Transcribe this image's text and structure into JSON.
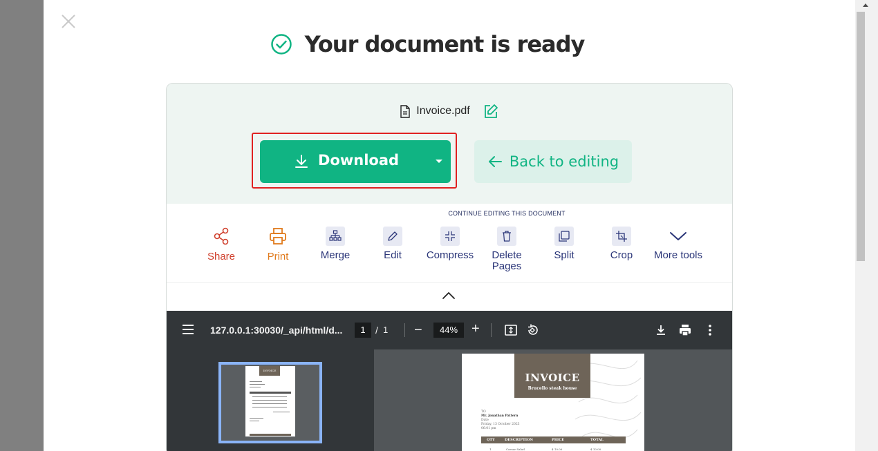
{
  "headline": {
    "title": "Your document is ready"
  },
  "file": {
    "name": "Invoice.pdf"
  },
  "actions": {
    "download_label": "Download",
    "back_label": "Back to editing"
  },
  "tools": {
    "section_label": "CONTINUE EDITING THIS DOCUMENT",
    "items": [
      {
        "label": "Share",
        "icon": "share-icon",
        "color": "#d0412e"
      },
      {
        "label": "Print",
        "icon": "printer-icon",
        "color": "#e07a1c"
      },
      {
        "label": "Merge",
        "icon": "merge-icon"
      },
      {
        "label": "Edit",
        "icon": "pencil-icon"
      },
      {
        "label": "Compress",
        "icon": "compress-icon"
      },
      {
        "label": "Delete Pages",
        "icon": "trash-icon"
      },
      {
        "label": "Split",
        "icon": "split-icon"
      },
      {
        "label": "Crop",
        "icon": "crop-icon"
      },
      {
        "label": "More tools",
        "icon": "chevron-down-icon"
      }
    ]
  },
  "viewer": {
    "url": "127.0.0.1:30030/_api/html/d...",
    "page_current": "1",
    "page_separator": "/",
    "page_total": "1",
    "zoom": "44%",
    "zoom_out": "−",
    "zoom_in": "+"
  },
  "invoice_preview": {
    "title": "INVOICE",
    "subtitle": "Brucello steak house",
    "to_label": "TO",
    "to_name": "Mr. Jonathan Pattern",
    "to_line2": "Date",
    "to_date": "Friday, 13 October 2023",
    "to_time": "06:01 pm",
    "table_headers": [
      "QTY",
      "DESCRIPTION",
      "PRICE",
      "TOTAL"
    ],
    "first_row": [
      "1",
      "Caesar Salad",
      "$ 10.00",
      "$ 10.00"
    ]
  },
  "colors": {
    "accent": "#10b483",
    "highlight": "#e02020",
    "tool_text": "#2a3578"
  }
}
